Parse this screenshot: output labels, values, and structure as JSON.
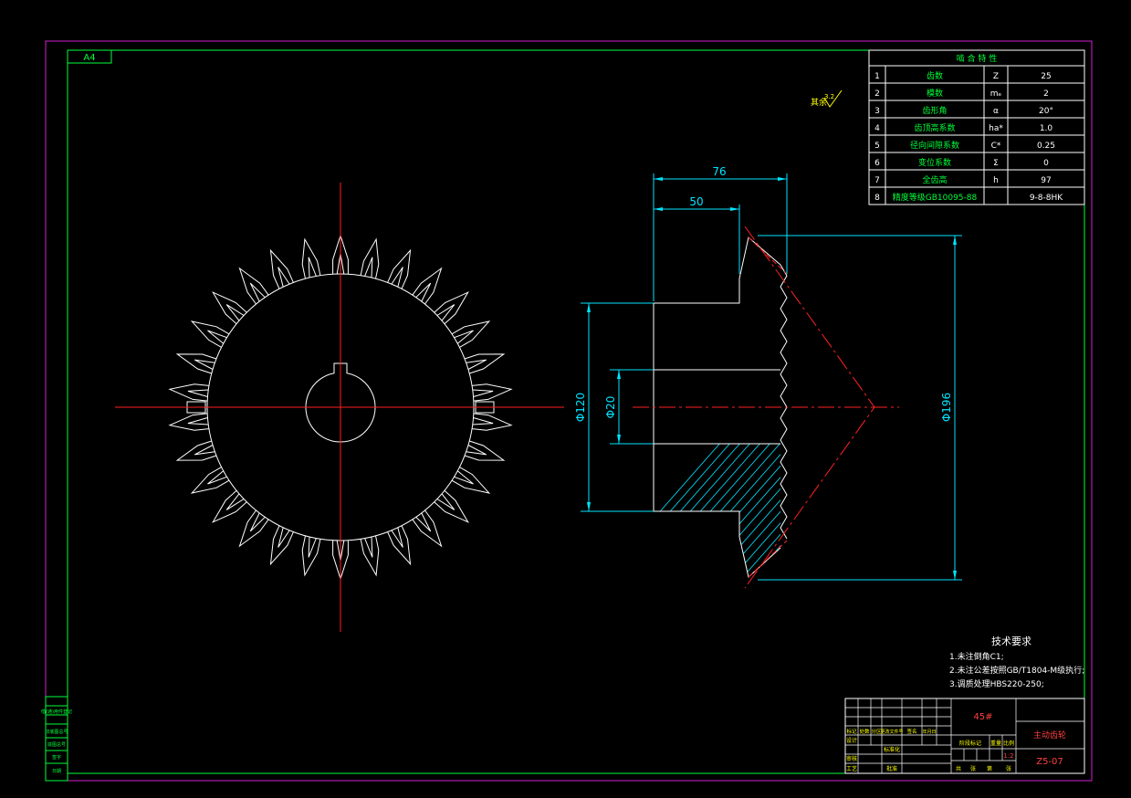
{
  "sheet": {
    "size_label": "A4"
  },
  "surface_symbol": {
    "label": "其余",
    "value": "3.2"
  },
  "gear_table": {
    "title": "啮 合 特 性",
    "rows": [
      {
        "no": "1",
        "name": "齿数",
        "symbol": "Z",
        "value": "25"
      },
      {
        "no": "2",
        "name": "模数",
        "symbol": "mₑ",
        "value": "2"
      },
      {
        "no": "3",
        "name": "齿形角",
        "symbol": "α",
        "value": "20°"
      },
      {
        "no": "4",
        "name": "齿顶高系数",
        "symbol": "ha*",
        "value": "1.0"
      },
      {
        "no": "5",
        "name": "径向间隙系数",
        "symbol": "C*",
        "value": "0.25"
      },
      {
        "no": "6",
        "name": "变位系数",
        "symbol": "Σ",
        "value": "0"
      },
      {
        "no": "7",
        "name": "全齿高",
        "symbol": "h",
        "value": "97"
      },
      {
        "no": "8",
        "name": "精度等级GB10095-88",
        "symbol": "",
        "value": "9-8-8HK"
      }
    ]
  },
  "dimensions": {
    "width_76": "76",
    "width_50": "50",
    "dia_120": "Φ120",
    "dia_20": "Φ20",
    "dia_196": "Φ196"
  },
  "tech_req": {
    "title": "技术要求",
    "items": [
      "1.未注倒角C1;",
      "2.未注公差按照GB/T1804-M级执行;",
      "3.调质处理HBS220-250;"
    ]
  },
  "title_block": {
    "material": "45#",
    "part_name": "主动齿轮",
    "drawing_no": "Z5-07",
    "scale": "1:2",
    "header_cells": [
      "标记",
      "处数",
      "分区",
      "更改文件号",
      "签名",
      "年月日"
    ],
    "left_labels": [
      "设计",
      "审核",
      "工艺"
    ],
    "mid_labels": [
      "标准化",
      "批准"
    ],
    "stage_labels": [
      "阶段标记",
      "重量",
      "比例"
    ],
    "bottom_labels": [
      "共",
      "张",
      "第",
      "张"
    ]
  },
  "left_strip": [
    "借(通)用件登记",
    "",
    "旧底图总号",
    "底图总号",
    "签字",
    "日期"
  ],
  "colors": {
    "background": "#000000",
    "outline": "#ffffff",
    "dimension": "#00e5ff",
    "centerline": "#ff2020",
    "frame": "#00ff3a",
    "border": "#d020d0",
    "text_accent": "#ffff00"
  }
}
